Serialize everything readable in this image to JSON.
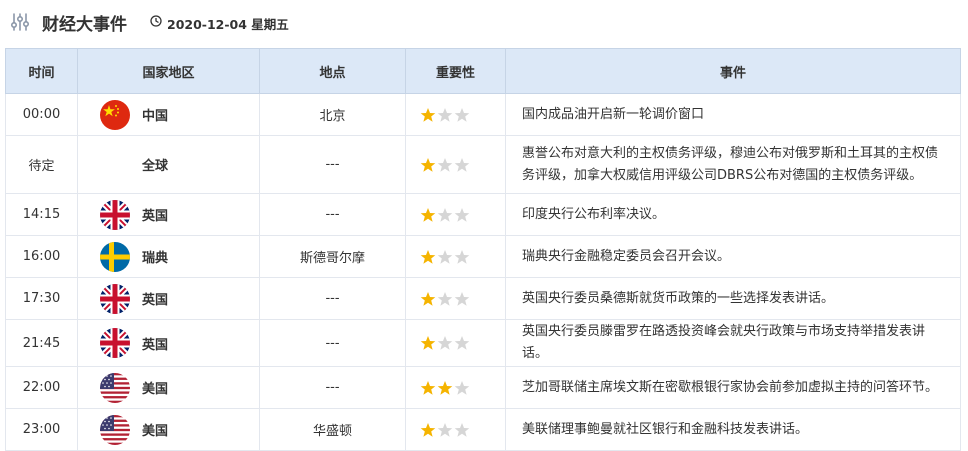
{
  "header": {
    "title": "财经大事件",
    "date": "2020-12-04 星期五"
  },
  "columns": [
    "时间",
    "国家地区",
    "地点",
    "重要性",
    "事件"
  ],
  "rows": [
    {
      "time": "00:00",
      "flag": "cn",
      "country": "中国",
      "location": "北京",
      "importance": 1,
      "event": "国内成品油开启新一轮调价窗口"
    },
    {
      "time": "待定",
      "flag": "",
      "country": "全球",
      "location": "---",
      "importance": 1,
      "event": "惠誉公布对意大利的主权债务评级，穆迪公布对俄罗斯和土耳其的主权债务评级，加拿大权威信用评级公司DBRS公布对德国的主权债务评级。"
    },
    {
      "time": "14:15",
      "flag": "uk",
      "country": "英国",
      "location": "---",
      "importance": 1,
      "event": "印度央行公布利率决议。"
    },
    {
      "time": "16:00",
      "flag": "se",
      "country": "瑞典",
      "location": "斯德哥尔摩",
      "importance": 1,
      "event": "瑞典央行金融稳定委员会召开会议。"
    },
    {
      "time": "17:30",
      "flag": "uk",
      "country": "英国",
      "location": "---",
      "importance": 1,
      "event": "英国央行委员桑德斯就货币政策的一些选择发表讲话。"
    },
    {
      "time": "21:45",
      "flag": "uk",
      "country": "英国",
      "location": "---",
      "importance": 1,
      "event": "英国央行委员滕雷罗在路透投资峰会就央行政策与市场支持举措发表讲话。"
    },
    {
      "time": "22:00",
      "flag": "us",
      "country": "美国",
      "location": "---",
      "importance": 2,
      "event": "芝加哥联储主席埃文斯在密歇根银行家协会前参加虚拟主持的问答环节。"
    },
    {
      "time": "23:00",
      "flag": "us",
      "country": "美国",
      "location": "华盛顿",
      "importance": 1,
      "event": "美联储理事鲍曼就社区银行和金融科技发表讲话。"
    }
  ],
  "colors": {
    "header_bg": "#dce8f7",
    "star_on": "#f5b400",
    "star_off": "#d6d6d6"
  }
}
